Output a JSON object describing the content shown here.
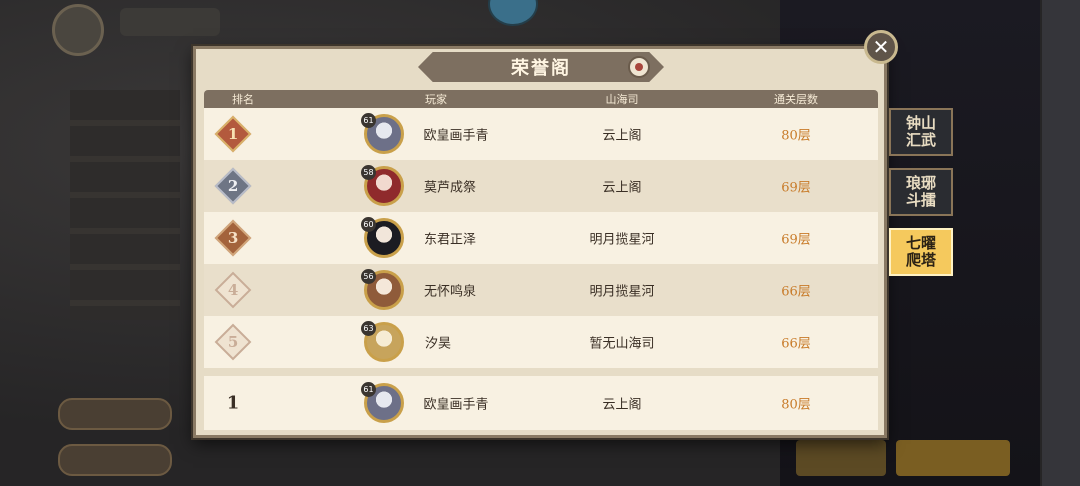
{
  "dialog": {
    "title": "荣誉阁",
    "close_label": "✕"
  },
  "table": {
    "headers": {
      "rank": "排名",
      "player": "玩家",
      "guild": "山海司",
      "floors": "通关层数"
    },
    "rows": [
      {
        "rank": "1",
        "level": "61",
        "player": "欧皇画手青",
        "guild": "云上阁",
        "floors": "80层"
      },
      {
        "rank": "2",
        "level": "58",
        "player": "莫芦成祭",
        "guild": "云上阁",
        "floors": "69层"
      },
      {
        "rank": "3",
        "level": "60",
        "player": "东君正泽",
        "guild": "明月揽星河",
        "floors": "69层"
      },
      {
        "rank": "4",
        "level": "56",
        "player": "无怀鸣泉",
        "guild": "明月揽星河",
        "floors": "66层"
      },
      {
        "rank": "5",
        "level": "63",
        "player": "汐昊",
        "guild": "暂无山海司",
        "floors": "66层"
      }
    ],
    "self": {
      "rank": "1",
      "level": "61",
      "player": "欧皇画手青",
      "guild": "云上阁",
      "floors": "80层"
    }
  },
  "tabs": [
    {
      "label": "钟山汇武",
      "active": false
    },
    {
      "label": "琅琊斗擂",
      "active": false
    },
    {
      "label": "七曜爬塔",
      "active": true
    }
  ],
  "colors": {
    "floor_text": "#c87b29",
    "active_tab": "#f5c95d",
    "header_bar": "#7d6f60"
  }
}
